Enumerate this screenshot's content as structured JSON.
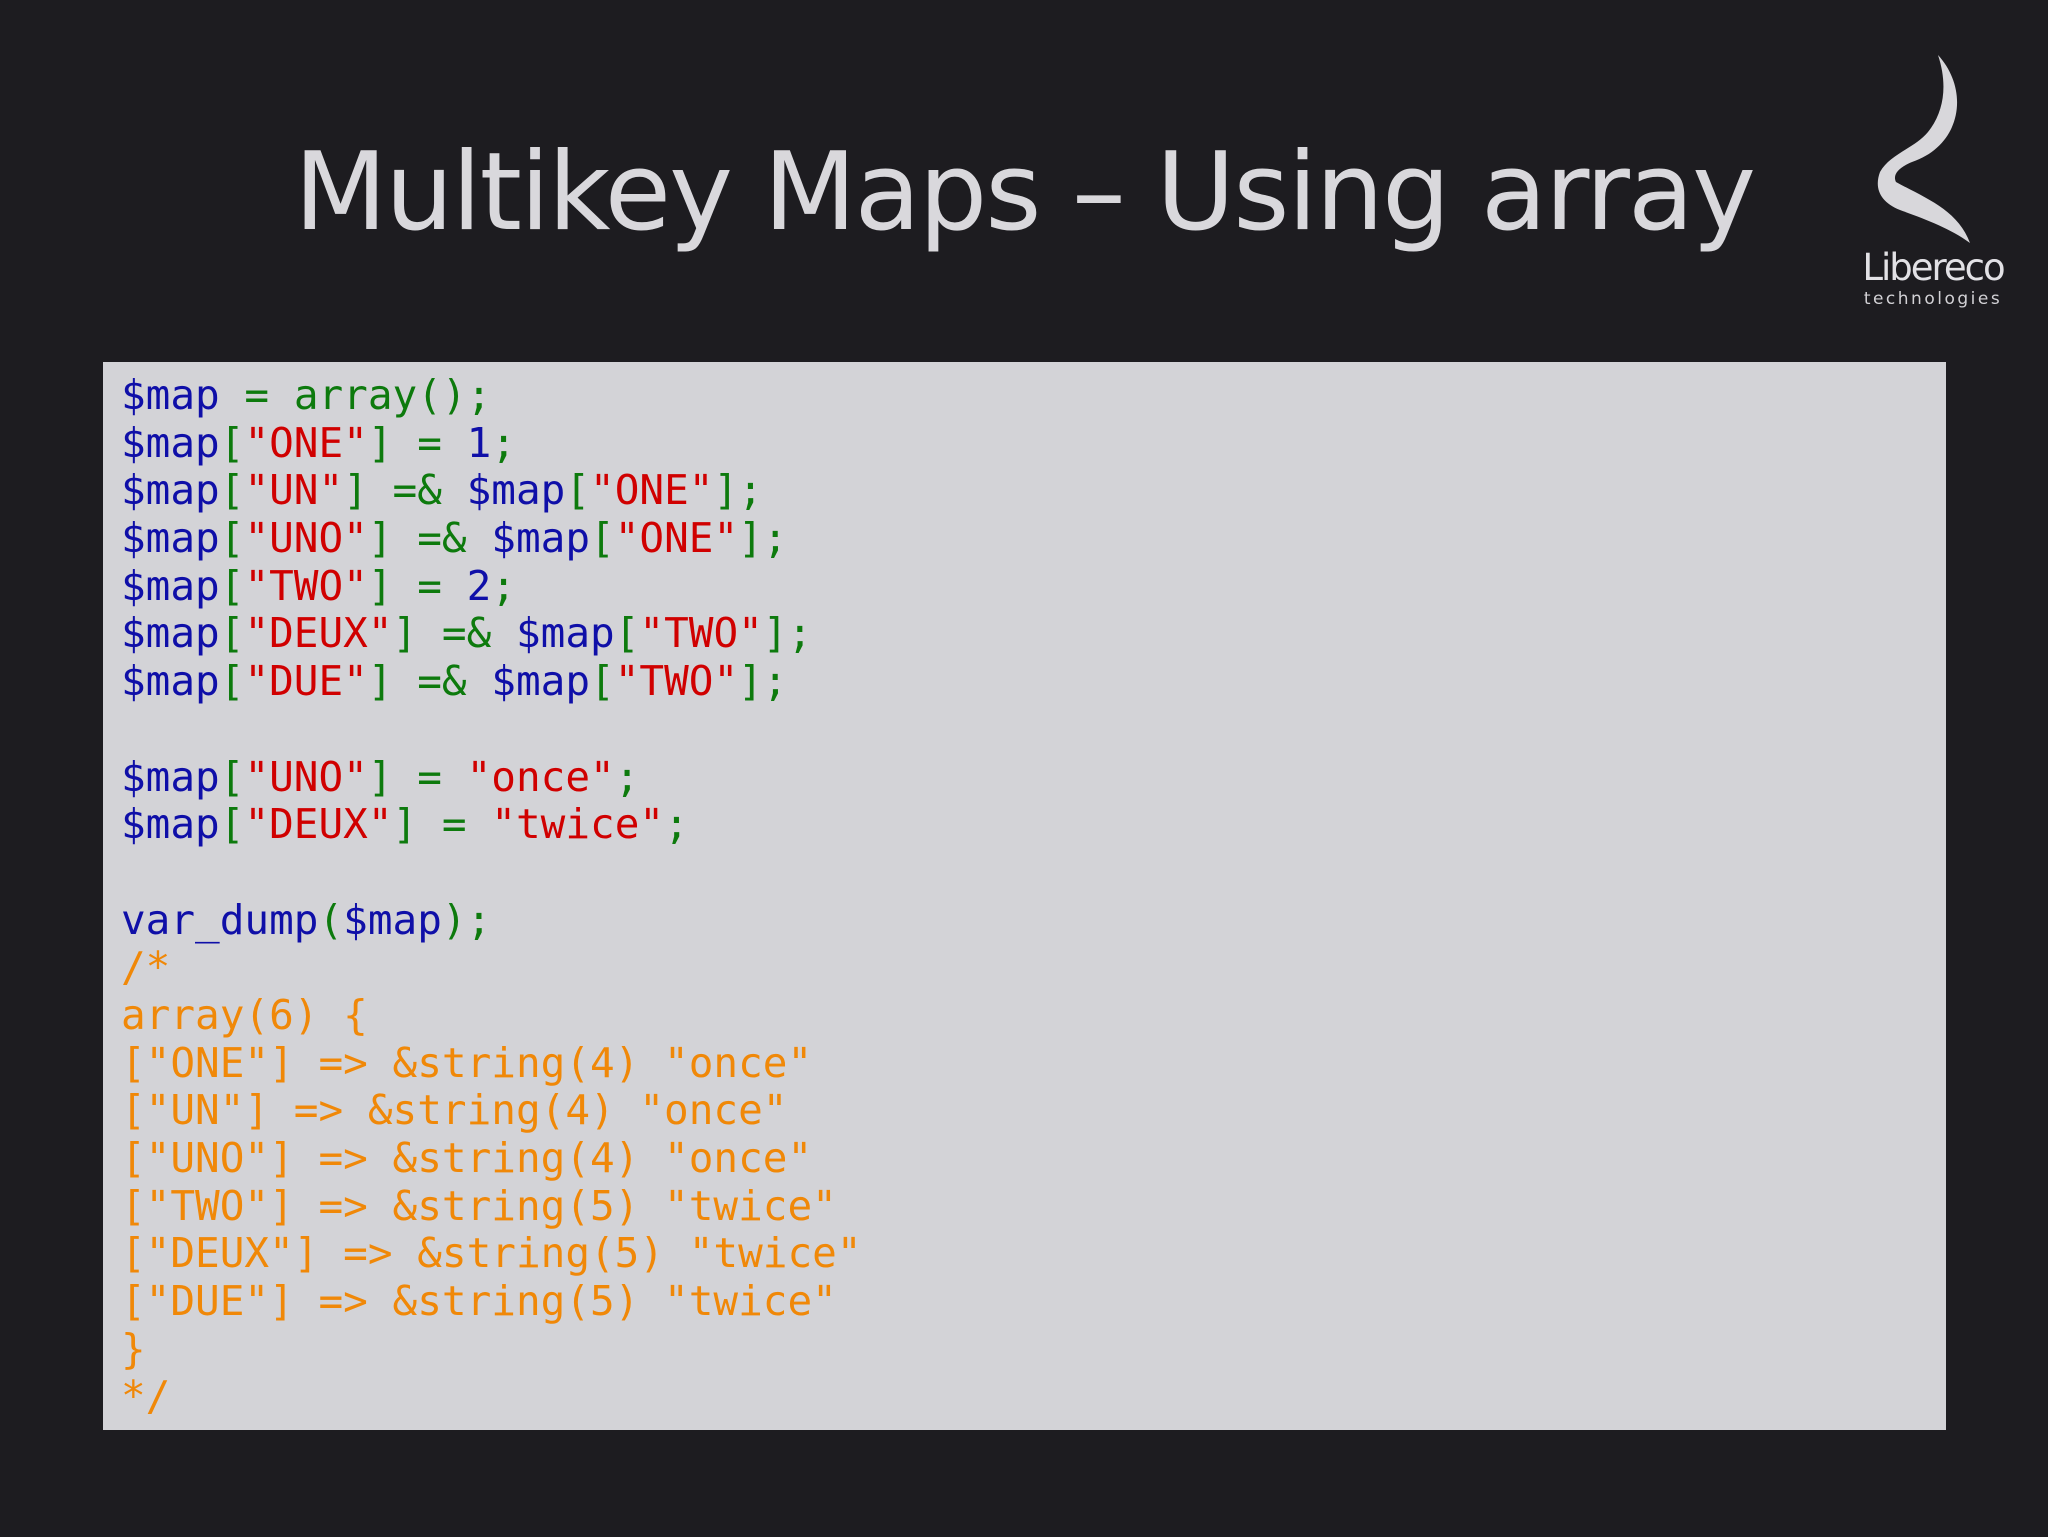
{
  "slide": {
    "title": "Multikey Maps  – Using array"
  },
  "logo": {
    "name": "Libereco",
    "subtitle": "technologies"
  },
  "code": {
    "lines": [
      [
        {
          "t": "$map",
          "c": "var"
        },
        {
          "t": " = ",
          "c": "op"
        },
        {
          "t": "array();",
          "c": "fn"
        }
      ],
      [
        {
          "t": "$map",
          "c": "var"
        },
        {
          "t": "[",
          "c": "punc"
        },
        {
          "t": "\"ONE\"",
          "c": "str"
        },
        {
          "t": "] = ",
          "c": "punc"
        },
        {
          "t": "1",
          "c": "num"
        },
        {
          "t": ";",
          "c": "punc"
        }
      ],
      [
        {
          "t": "$map",
          "c": "var"
        },
        {
          "t": "[",
          "c": "punc"
        },
        {
          "t": "\"UN\"",
          "c": "str"
        },
        {
          "t": "] =& ",
          "c": "punc"
        },
        {
          "t": "$map",
          "c": "var"
        },
        {
          "t": "[",
          "c": "punc"
        },
        {
          "t": "\"ONE\"",
          "c": "str"
        },
        {
          "t": "];",
          "c": "punc"
        }
      ],
      [
        {
          "t": "$map",
          "c": "var"
        },
        {
          "t": "[",
          "c": "punc"
        },
        {
          "t": "\"UNO\"",
          "c": "str"
        },
        {
          "t": "] =& ",
          "c": "punc"
        },
        {
          "t": "$map",
          "c": "var"
        },
        {
          "t": "[",
          "c": "punc"
        },
        {
          "t": "\"ONE\"",
          "c": "str"
        },
        {
          "t": "];",
          "c": "punc"
        }
      ],
      [
        {
          "t": "$map",
          "c": "var"
        },
        {
          "t": "[",
          "c": "punc"
        },
        {
          "t": "\"TWO\"",
          "c": "str"
        },
        {
          "t": "] = ",
          "c": "punc"
        },
        {
          "t": "2",
          "c": "num"
        },
        {
          "t": ";",
          "c": "punc"
        }
      ],
      [
        {
          "t": "$map",
          "c": "var"
        },
        {
          "t": "[",
          "c": "punc"
        },
        {
          "t": "\"DEUX\"",
          "c": "str"
        },
        {
          "t": "] =& ",
          "c": "punc"
        },
        {
          "t": "$map",
          "c": "var"
        },
        {
          "t": "[",
          "c": "punc"
        },
        {
          "t": "\"TWO\"",
          "c": "str"
        },
        {
          "t": "];",
          "c": "punc"
        }
      ],
      [
        {
          "t": "$map",
          "c": "var"
        },
        {
          "t": "[",
          "c": "punc"
        },
        {
          "t": "\"DUE\"",
          "c": "str"
        },
        {
          "t": "] =& ",
          "c": "punc"
        },
        {
          "t": "$map",
          "c": "var"
        },
        {
          "t": "[",
          "c": "punc"
        },
        {
          "t": "\"TWO\"",
          "c": "str"
        },
        {
          "t": "];",
          "c": "punc"
        }
      ],
      [],
      [
        {
          "t": "$map",
          "c": "var"
        },
        {
          "t": "[",
          "c": "punc"
        },
        {
          "t": "\"UNO\"",
          "c": "str"
        },
        {
          "t": "] = ",
          "c": "punc"
        },
        {
          "t": "\"once\"",
          "c": "str"
        },
        {
          "t": ";",
          "c": "punc"
        }
      ],
      [
        {
          "t": "$map",
          "c": "var"
        },
        {
          "t": "[",
          "c": "punc"
        },
        {
          "t": "\"DEUX\"",
          "c": "str"
        },
        {
          "t": "] = ",
          "c": "punc"
        },
        {
          "t": "\"twice\"",
          "c": "str"
        },
        {
          "t": ";",
          "c": "punc"
        }
      ],
      [],
      [
        {
          "t": "var_dump",
          "c": "call"
        },
        {
          "t": "(",
          "c": "punc"
        },
        {
          "t": "$map",
          "c": "var"
        },
        {
          "t": ");",
          "c": "punc"
        }
      ],
      [
        {
          "t": "/*",
          "c": "cmt"
        }
      ],
      [
        {
          "t": "array(6) {",
          "c": "cmt"
        }
      ],
      [
        {
          "t": "[\"ONE\"] => &string(4) \"once\"",
          "c": "cmt"
        }
      ],
      [
        {
          "t": "[\"UN\"] => &string(4) \"once\"",
          "c": "cmt"
        }
      ],
      [
        {
          "t": "[\"UNO\"] => &string(4) \"once\"",
          "c": "cmt"
        }
      ],
      [
        {
          "t": "[\"TWO\"] => &string(5) \"twice\"",
          "c": "cmt"
        }
      ],
      [
        {
          "t": "[\"DEUX\"] => &string(5) \"twice\"",
          "c": "cmt"
        }
      ],
      [
        {
          "t": "[\"DUE\"] => &string(5) \"twice\"",
          "c": "cmt"
        }
      ],
      [
        {
          "t": "}",
          "c": "cmt"
        }
      ],
      [
        {
          "t": "*/",
          "c": "cmt"
        }
      ]
    ]
  }
}
